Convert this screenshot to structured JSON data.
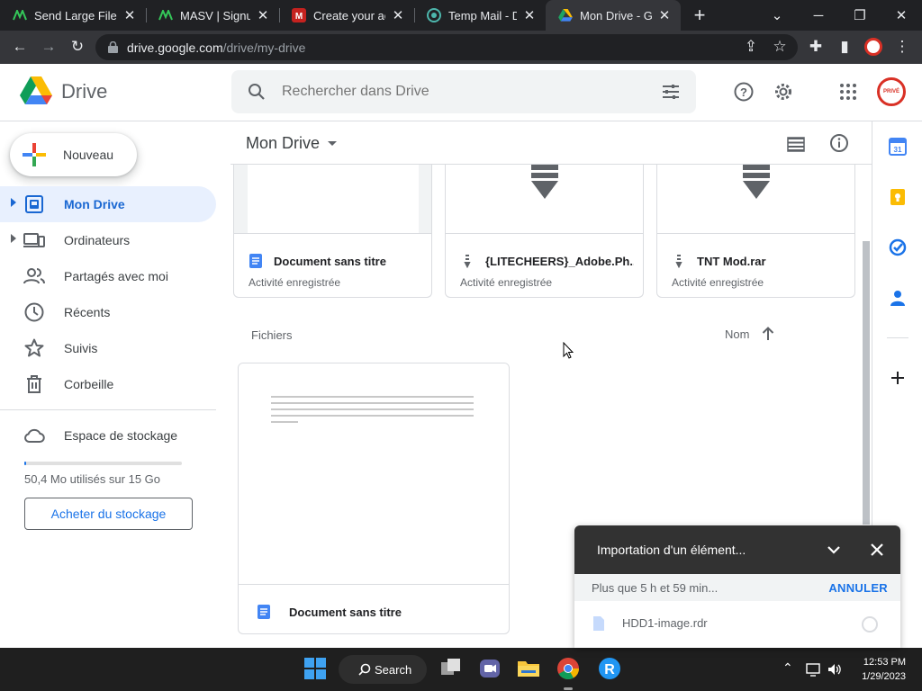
{
  "browser": {
    "tabs": [
      {
        "title": "Send Large Files",
        "active": false
      },
      {
        "title": "MASV | Signup",
        "active": false
      },
      {
        "title": "Create your acc",
        "active": false
      },
      {
        "title": "Temp Mail - Disp",
        "active": false
      },
      {
        "title": "Mon Drive - Goo",
        "active": true
      }
    ],
    "url_host": "drive.google.com",
    "url_path": "/drive/my-drive"
  },
  "header": {
    "brand": "Drive",
    "search_placeholder": "Rechercher dans Drive",
    "avatar_text": "PRIVÉ"
  },
  "sidebar": {
    "new_label": "Nouveau",
    "items": [
      {
        "label": "Mon Drive",
        "icon": "my-drive-icon",
        "active": true,
        "caret": true
      },
      {
        "label": "Ordinateurs",
        "icon": "computers-icon",
        "active": false,
        "caret": true
      },
      {
        "label": "Partagés avec moi",
        "icon": "shared-icon",
        "active": false,
        "caret": false
      },
      {
        "label": "Récents",
        "icon": "clock-icon",
        "active": false,
        "caret": false
      },
      {
        "label": "Suivis",
        "icon": "star-icon",
        "active": false,
        "caret": false
      },
      {
        "label": "Corbeille",
        "icon": "trash-icon",
        "active": false,
        "caret": false
      }
    ],
    "storage_label": "Espace de stockage",
    "storage_used": "50,4 Mo utilisés sur 15 Go",
    "storage_fraction": 0.003,
    "buy_label": "Acheter du stockage"
  },
  "main": {
    "title": "Mon Drive",
    "suggested": [
      {
        "name": "Document sans titre",
        "subtitle": "Activité enregistrée",
        "type": "doc"
      },
      {
        "name": "{LITECHEERS}_Adobe.Ph...",
        "subtitle": "Activité enregistrée",
        "type": "archive"
      },
      {
        "name": "TNT Mod.rar",
        "subtitle": "Activité enregistrée",
        "type": "archive"
      }
    ],
    "files_heading": "Fichiers",
    "sort_label": "Nom",
    "files": [
      {
        "name": "Document sans titre",
        "type": "doc"
      }
    ]
  },
  "upload": {
    "title": "Importation d'un élément...",
    "time_left": "Plus que 5 h et 59 min...",
    "cancel_label": "ANNULER",
    "file_name": "HDD1-image.rdr"
  },
  "taskbar": {
    "search_label": "Search",
    "time": "12:53 PM",
    "date": "1/29/2023"
  },
  "colors": {
    "accent": "#1a73e8",
    "active_nav_bg": "#e8f0fe",
    "upload_header": "#323232"
  }
}
